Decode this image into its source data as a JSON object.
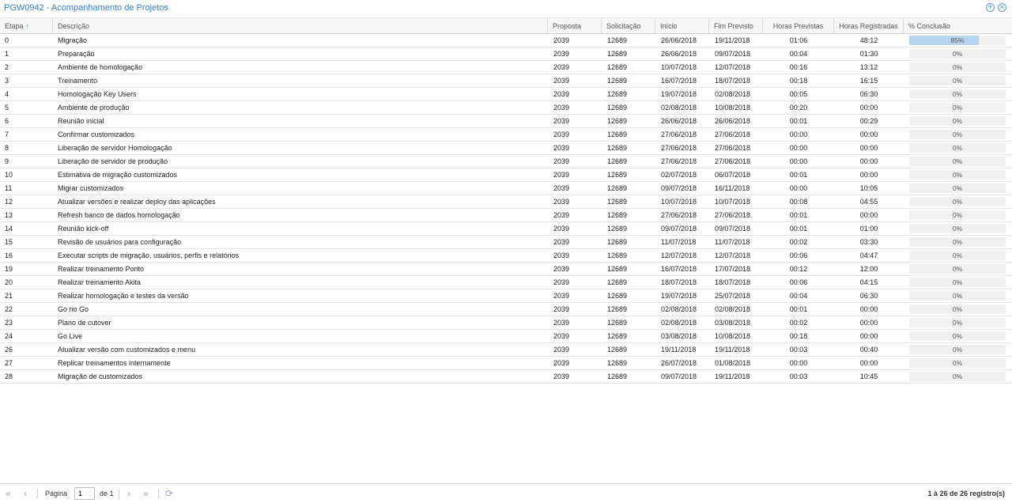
{
  "window": {
    "title": "PGW0942 - Acompanhamento de Projetos"
  },
  "tools": {
    "expand_icon": "plus-circle-icon",
    "close_icon": "close-circle-icon"
  },
  "columns": {
    "etapa": "Etapa",
    "descricao": "Descrição",
    "proposta": "Proposta",
    "solicitacao": "Solicitação",
    "inicio": "Início",
    "fim_previsto": "Fim Previsto",
    "horas_previstas": "Horas Previstas",
    "horas_registradas": "Horas Registradas",
    "conclusao": "% Conclusão",
    "sort_indicator": "↑"
  },
  "rows": [
    {
      "etapa": "0",
      "descricao": "Migração",
      "proposta": "2039",
      "solicitacao": "12689",
      "inicio": "26/06/2018",
      "fim": "19/11/2018",
      "hp": "01:06",
      "hr": "48:12",
      "pct": "85%",
      "pct_value": 0.85
    },
    {
      "etapa": "1",
      "descricao": "Preparação",
      "proposta": "2039",
      "solicitacao": "12689",
      "inicio": "26/06/2018",
      "fim": "09/07/2018",
      "hp": "00:04",
      "hr": "01:30",
      "pct": "0%",
      "pct_value": 0
    },
    {
      "etapa": "2",
      "descricao": "Ambiente de homologação",
      "proposta": "2039",
      "solicitacao": "12689",
      "inicio": "10/07/2018",
      "fim": "12/07/2018",
      "hp": "00:16",
      "hr": "13:12",
      "pct": "0%",
      "pct_value": 0
    },
    {
      "etapa": "3",
      "descricao": "Treinamento",
      "proposta": "2039",
      "solicitacao": "12689",
      "inicio": "16/07/2018",
      "fim": "18/07/2018",
      "hp": "00:18",
      "hr": "16:15",
      "pct": "0%",
      "pct_value": 0
    },
    {
      "etapa": "4",
      "descricao": "Homologação Key Users",
      "proposta": "2039",
      "solicitacao": "12689",
      "inicio": "19/07/2018",
      "fim": "02/08/2018",
      "hp": "00:05",
      "hr": "06:30",
      "pct": "0%",
      "pct_value": 0
    },
    {
      "etapa": "5",
      "descricao": "Ambiente de produção",
      "proposta": "2039",
      "solicitacao": "12689",
      "inicio": "02/08/2018",
      "fim": "10/08/2018",
      "hp": "00:20",
      "hr": "00:00",
      "pct": "0%",
      "pct_value": 0
    },
    {
      "etapa": "6",
      "descricao": "Reunião inicial",
      "proposta": "2039",
      "solicitacao": "12689",
      "inicio": "26/06/2018",
      "fim": "26/06/2018",
      "hp": "00:01",
      "hr": "00:29",
      "pct": "0%",
      "pct_value": 0
    },
    {
      "etapa": "7",
      "descricao": "Confirmar customizados",
      "proposta": "2039",
      "solicitacao": "12689",
      "inicio": "27/06/2018",
      "fim": "27/06/2018",
      "hp": "00:00",
      "hr": "00:00",
      "pct": "0%",
      "pct_value": 0
    },
    {
      "etapa": "8",
      "descricao": "Liberação de servidor Homologação",
      "proposta": "2039",
      "solicitacao": "12689",
      "inicio": "27/06/2018",
      "fim": "27/06/2018",
      "hp": "00:00",
      "hr": "00:00",
      "pct": "0%",
      "pct_value": 0
    },
    {
      "etapa": "9",
      "descricao": "Liberação de servidor de produção",
      "proposta": "2039",
      "solicitacao": "12689",
      "inicio": "27/06/2018",
      "fim": "27/06/2018",
      "hp": "00:00",
      "hr": "00:00",
      "pct": "0%",
      "pct_value": 0
    },
    {
      "etapa": "10",
      "descricao": "Estimativa de migração customizados",
      "proposta": "2039",
      "solicitacao": "12689",
      "inicio": "02/07/2018",
      "fim": "06/07/2018",
      "hp": "00:01",
      "hr": "00:00",
      "pct": "0%",
      "pct_value": 0
    },
    {
      "etapa": "11",
      "descricao": "Migrar customizados",
      "proposta": "2039",
      "solicitacao": "12689",
      "inicio": "09/07/2018",
      "fim": "16/11/2018",
      "hp": "00:00",
      "hr": "10:05",
      "pct": "0%",
      "pct_value": 0
    },
    {
      "etapa": "12",
      "descricao": "Atualizar versões e realizar deploy das aplicações",
      "proposta": "2039",
      "solicitacao": "12689",
      "inicio": "10/07/2018",
      "fim": "10/07/2018",
      "hp": "00:08",
      "hr": "04:55",
      "pct": "0%",
      "pct_value": 0
    },
    {
      "etapa": "13",
      "descricao": "Refresh banco de dados homologação",
      "proposta": "2039",
      "solicitacao": "12689",
      "inicio": "27/06/2018",
      "fim": "27/06/2018",
      "hp": "00:01",
      "hr": "00:00",
      "pct": "0%",
      "pct_value": 0
    },
    {
      "etapa": "14",
      "descricao": "Reunião kick-off",
      "proposta": "2039",
      "solicitacao": "12689",
      "inicio": "09/07/2018",
      "fim": "09/07/2018",
      "hp": "00:01",
      "hr": "01:00",
      "pct": "0%",
      "pct_value": 0
    },
    {
      "etapa": "15",
      "descricao": "Revisão de usuários para configuração",
      "proposta": "2039",
      "solicitacao": "12689",
      "inicio": "11/07/2018",
      "fim": "11/07/2018",
      "hp": "00:02",
      "hr": "03:30",
      "pct": "0%",
      "pct_value": 0
    },
    {
      "etapa": "16",
      "descricao": "Executar scripts de migração, usuários, perfis e relatórios",
      "proposta": "2039",
      "solicitacao": "12689",
      "inicio": "12/07/2018",
      "fim": "12/07/2018",
      "hp": "00:06",
      "hr": "04:47",
      "pct": "0%",
      "pct_value": 0
    },
    {
      "etapa": "19",
      "descricao": "Realizar treinamento Ponto",
      "proposta": "2039",
      "solicitacao": "12689",
      "inicio": "16/07/2018",
      "fim": "17/07/2018",
      "hp": "00:12",
      "hr": "12:00",
      "pct": "0%",
      "pct_value": 0
    },
    {
      "etapa": "20",
      "descricao": "Realizar treinamento Akita",
      "proposta": "2039",
      "solicitacao": "12689",
      "inicio": "18/07/2018",
      "fim": "18/07/2018",
      "hp": "00:06",
      "hr": "04:15",
      "pct": "0%",
      "pct_value": 0
    },
    {
      "etapa": "21",
      "descricao": "Realizar homologação e testes da versão",
      "proposta": "2039",
      "solicitacao": "12689",
      "inicio": "19/07/2018",
      "fim": "25/07/2018",
      "hp": "00:04",
      "hr": "06:30",
      "pct": "0%",
      "pct_value": 0
    },
    {
      "etapa": "22",
      "descricao": "Go no Go",
      "proposta": "2039",
      "solicitacao": "12689",
      "inicio": "02/08/2018",
      "fim": "02/08/2018",
      "hp": "00:01",
      "hr": "00:00",
      "pct": "0%",
      "pct_value": 0
    },
    {
      "etapa": "23",
      "descricao": "Plano de cutover",
      "proposta": "2039",
      "solicitacao": "12689",
      "inicio": "02/08/2018",
      "fim": "03/08/2018",
      "hp": "00:02",
      "hr": "00:00",
      "pct": "0%",
      "pct_value": 0
    },
    {
      "etapa": "24",
      "descricao": "Go Live",
      "proposta": "2039",
      "solicitacao": "12689",
      "inicio": "03/08/2018",
      "fim": "10/08/2018",
      "hp": "00:18",
      "hr": "00:00",
      "pct": "0%",
      "pct_value": 0
    },
    {
      "etapa": "26",
      "descricao": "Atualizar versão com customizados e menu",
      "proposta": "2039",
      "solicitacao": "12689",
      "inicio": "19/11/2018",
      "fim": "19/11/2018",
      "hp": "00:03",
      "hr": "00:40",
      "pct": "0%",
      "pct_value": 0
    },
    {
      "etapa": "27",
      "descricao": "Replicar treinamentos internamente",
      "proposta": "2039",
      "solicitacao": "12689",
      "inicio": "26/07/2018",
      "fim": "01/08/2018",
      "hp": "00:00",
      "hr": "00:00",
      "pct": "0%",
      "pct_value": 0
    },
    {
      "etapa": "28",
      "descricao": "Migração de customizados",
      "proposta": "2039",
      "solicitacao": "12689",
      "inicio": "09/07/2018",
      "fim": "19/11/2018",
      "hp": "00:03",
      "hr": "10:45",
      "pct": "0%",
      "pct_value": 0
    }
  ],
  "pager": {
    "page_label": "Página",
    "page_value": "1",
    "of_label": "de 1",
    "info": "1 à 26 de 26 registro(s)",
    "icons": [
      "first-page-icon",
      "prev-page-icon",
      "next-page-icon",
      "last-page-icon",
      "refresh-icon"
    ]
  },
  "colors": {
    "accent": "#3a7ec4",
    "progress_fill": "#b8d3ee"
  }
}
